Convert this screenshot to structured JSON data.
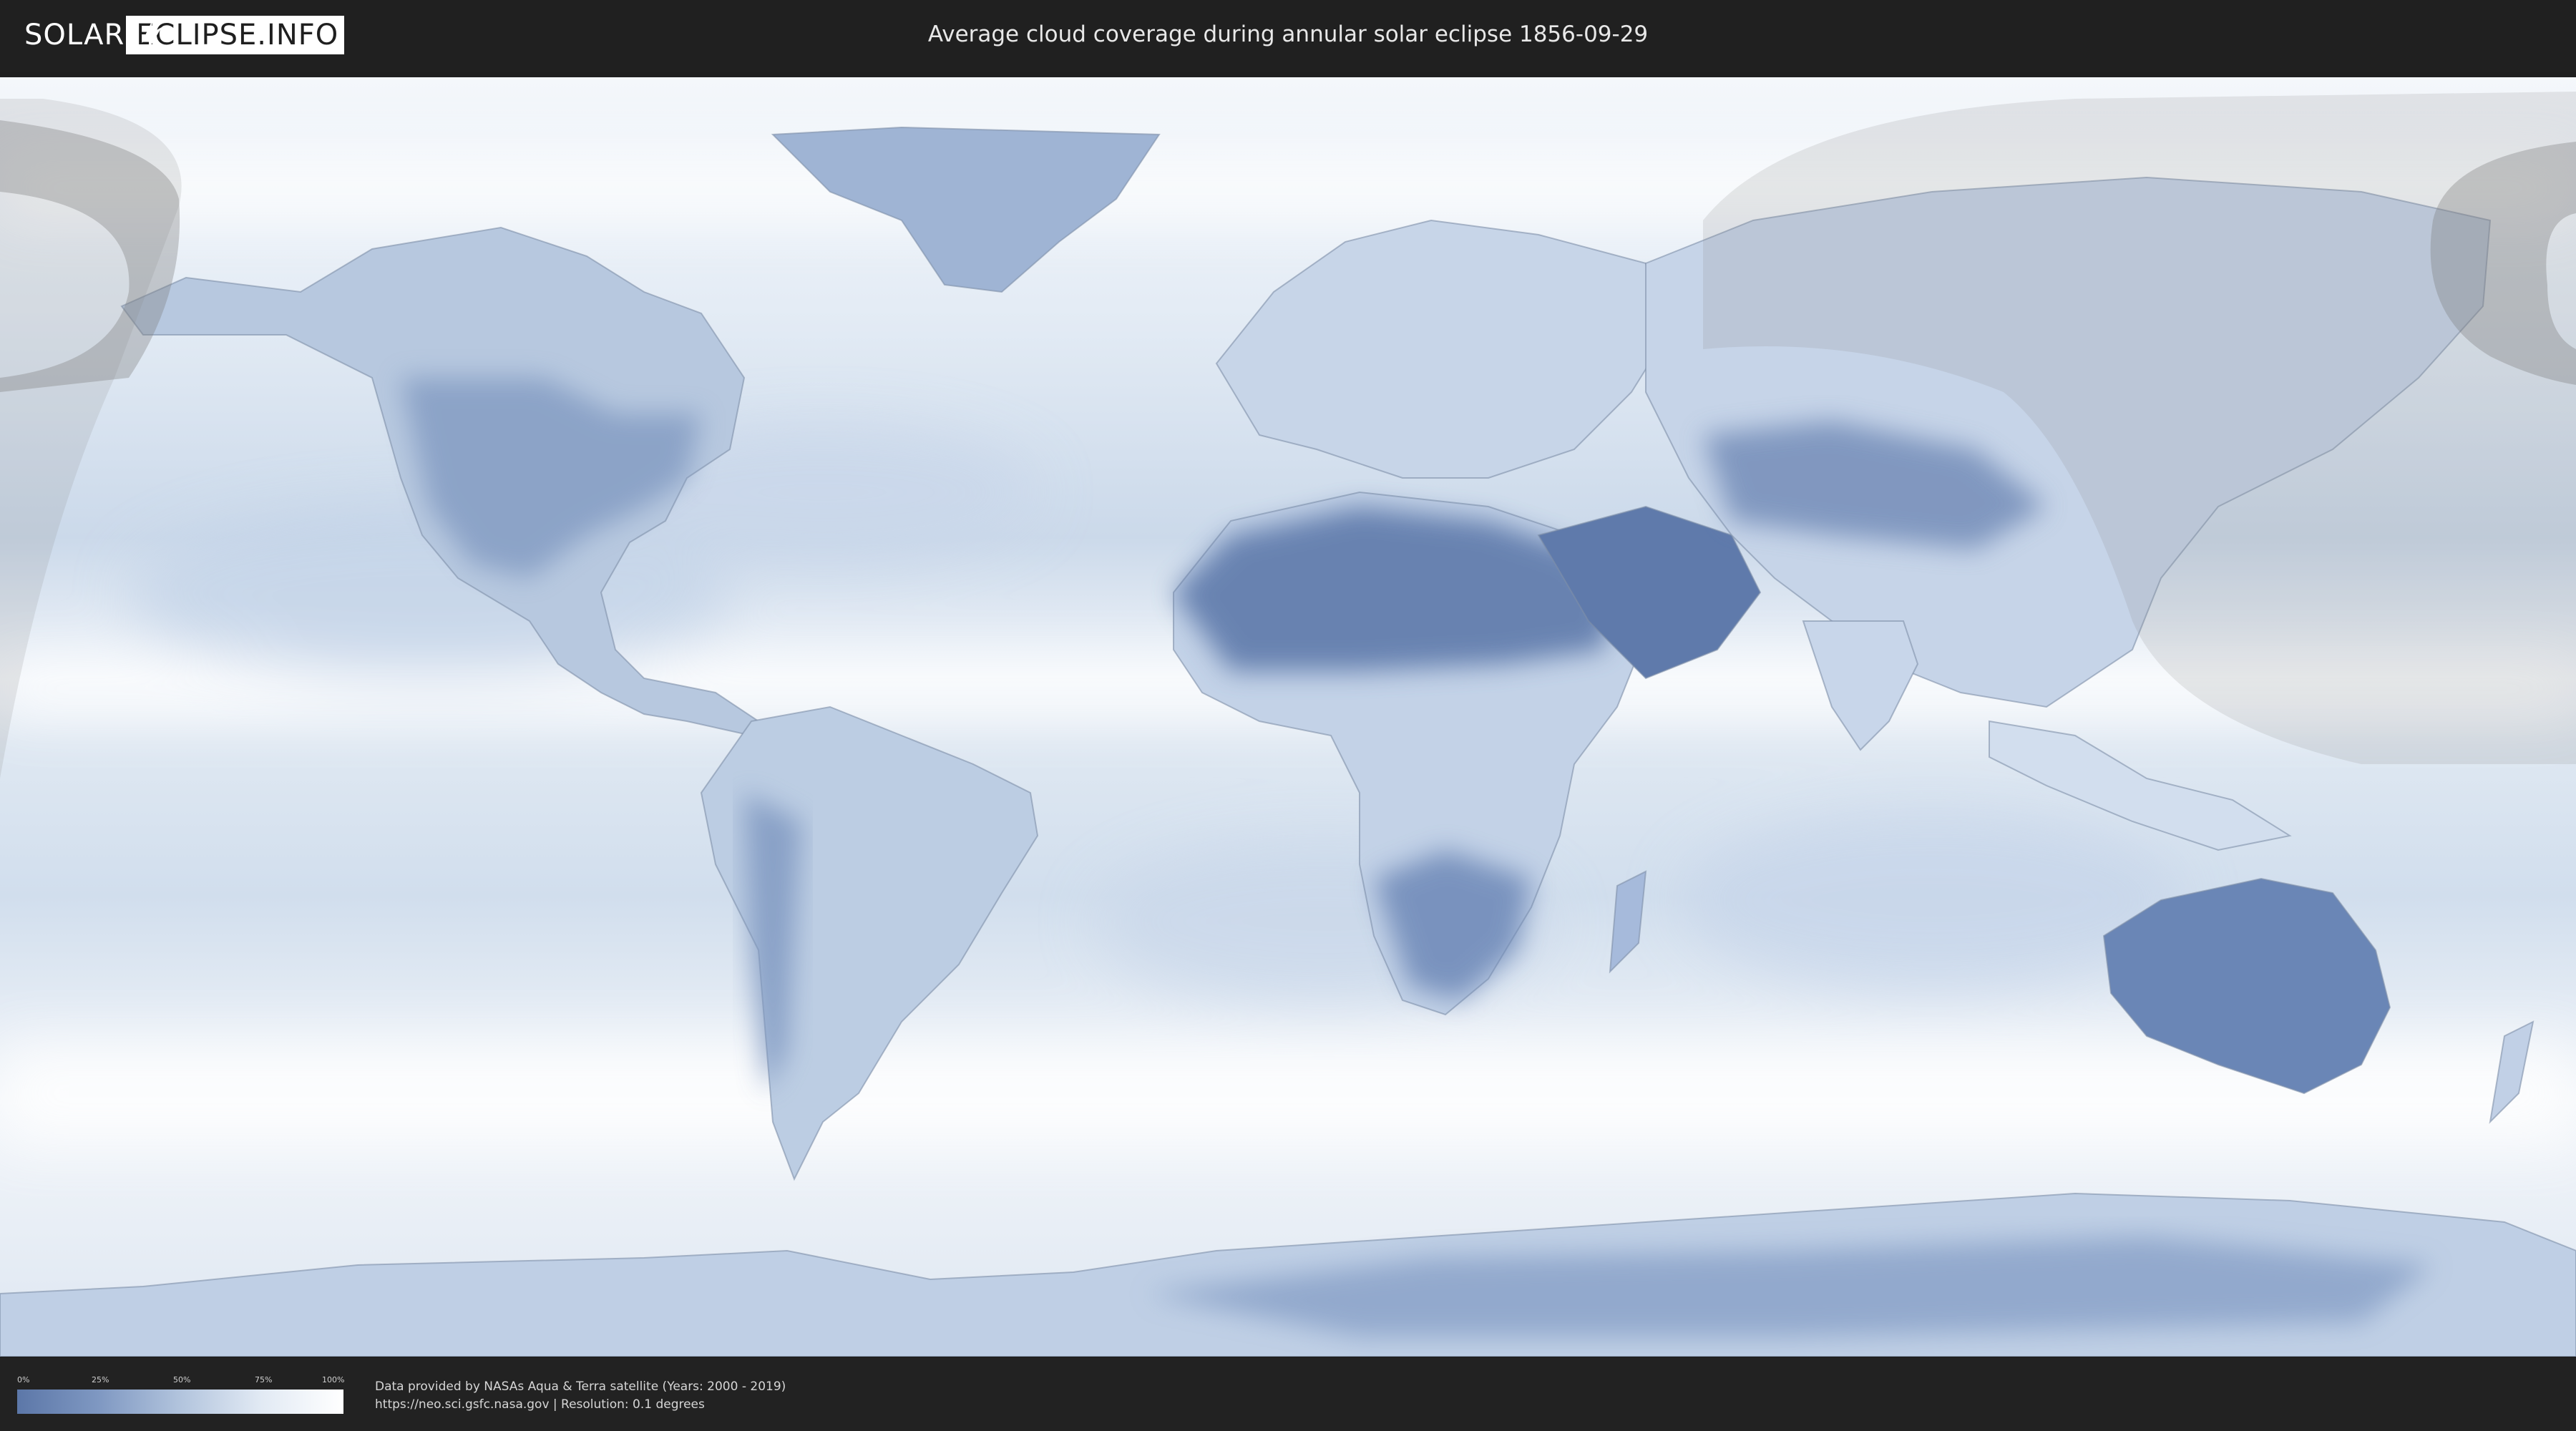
{
  "header": {
    "logo_left": "SOLAR",
    "logo_right": "ECLIPSE.INFO",
    "title": "Average cloud coverage during annular solar eclipse 1856-09-29"
  },
  "map": {
    "type": "cloud-coverage-world-map",
    "eclipse_date": "1856-09-29",
    "eclipse_type": "annular",
    "colors": {
      "ocean_clouds": "#e7eef6",
      "clear_land": "#6e89b6",
      "eclipse_shadow": "#9a9a9a"
    }
  },
  "legend": {
    "ticks": [
      "0%",
      "25%",
      "50%",
      "75%",
      "100%"
    ],
    "low_color": "#5c77a8",
    "high_color": "#ffffff"
  },
  "credits": {
    "line1": "Data provided by NASAs Aqua & Terra satellite (Years: 2000 - 2019)",
    "line2": "https://neo.sci.gsfc.nasa.gov | Resolution: 0.1 degrees"
  }
}
